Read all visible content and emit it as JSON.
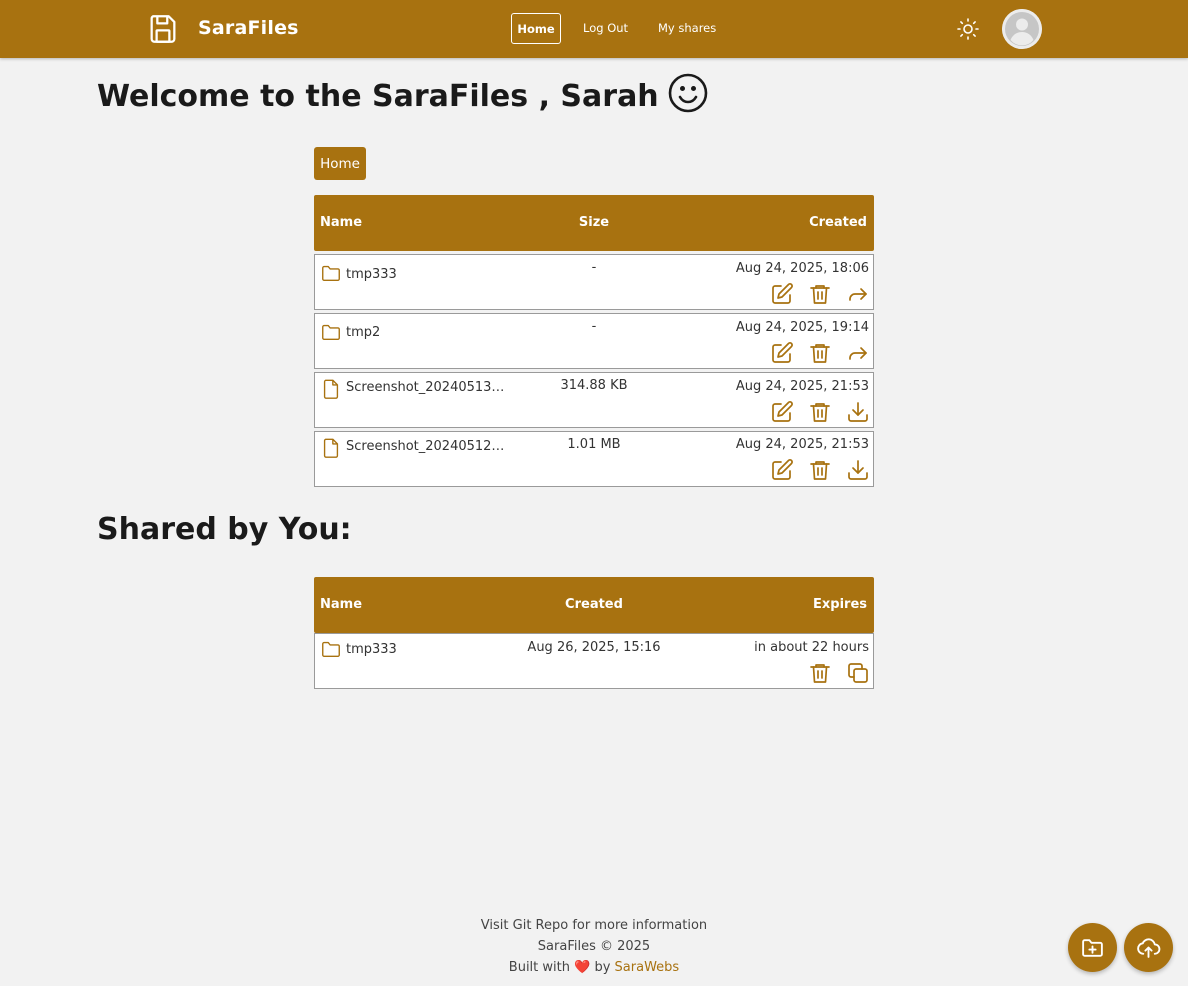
{
  "navbar": {
    "brand_name": "SaraFiles",
    "brand_icon": "save-icon",
    "home_label": "Home",
    "logout_label": "Log Out",
    "shares_label": "My shares",
    "theme_icon": "sun-icon",
    "avatar_icon": "user-avatar-icon"
  },
  "welcome": {
    "text": "Welcome to the SaraFiles , Sarah",
    "emoji_icon": "smiley-icon"
  },
  "breadcrumb": [
    "Home"
  ],
  "files_table": {
    "headers": {
      "name": "Name",
      "size": "Size",
      "created": "Created"
    },
    "rows": [
      {
        "type": "folder",
        "name": "tmp333",
        "size": "-",
        "created": "Aug 24, 2025, 18:06",
        "actions": [
          "edit-icon",
          "trash-icon",
          "share-icon"
        ]
      },
      {
        "type": "folder",
        "name": "tmp2",
        "size": "-",
        "created": "Aug 24, 2025, 19:14",
        "actions": [
          "edit-icon",
          "trash-icon",
          "share-icon"
        ]
      },
      {
        "type": "file",
        "name": "Screenshot_20240513…",
        "size": "314.88 KB",
        "created": "Aug 24, 2025, 21:53",
        "actions": [
          "edit-icon",
          "trash-icon",
          "download-icon"
        ]
      },
      {
        "type": "file",
        "name": "Screenshot_20240512…",
        "size": "1.01 MB",
        "created": "Aug 24, 2025, 21:53",
        "actions": [
          "edit-icon",
          "trash-icon",
          "download-icon"
        ]
      }
    ]
  },
  "shared": {
    "title": "Shared by You:",
    "headers": {
      "name": "Name",
      "created": "Created",
      "expires": "Expires"
    },
    "rows": [
      {
        "type": "folder",
        "name": "tmp333",
        "created": "Aug 26, 2025, 15:16",
        "expires": "in about 22 hours",
        "actions": [
          "trash-icon",
          "copy-icon"
        ]
      }
    ]
  },
  "footer": {
    "line1": "Visit Git Repo for more information",
    "line2": "SaraFiles © 2025",
    "built_prefix": "Built with",
    "heart": "❤️",
    "built_by": "by",
    "author_link": "SaraWebs"
  },
  "fab": {
    "new_folder_icon": "folder-plus-icon",
    "upload_icon": "cloud-upload-icon"
  },
  "colors": {
    "accent": "#a87210",
    "background": "#f2f2f2",
    "row_bg": "#ffffff"
  }
}
